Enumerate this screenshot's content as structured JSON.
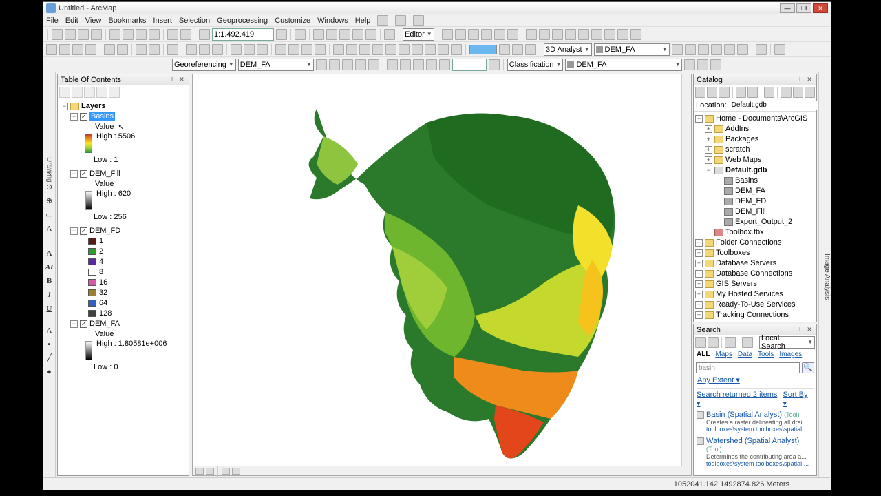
{
  "window": {
    "title": "Untitled - ArcMap"
  },
  "menu": [
    "File",
    "Edit",
    "View",
    "Bookmarks",
    "Insert",
    "Selection",
    "Geoprocessing",
    "Customize",
    "Windows",
    "Help"
  ],
  "toolbar1": {
    "scale": "1:1.492.419"
  },
  "toolbar2": {
    "analyst_label": "3D Analyst",
    "analyst_layer": "DEM_FA"
  },
  "toolbar3": {
    "georef_label": "Georeferencing",
    "georef_layer": "DEM_FA",
    "class_label": "Classification",
    "class_layer": "DEM_FA",
    "editor_label": "Editor"
  },
  "toc": {
    "title": "Table Of Contents",
    "root": "Layers",
    "layers": [
      {
        "name": "Basins",
        "selected": true,
        "value_label": "Value",
        "high": "High : 5506",
        "low": "Low : 1",
        "ramp": "greenred"
      },
      {
        "name": "DEM_Fill",
        "value_label": "Value",
        "high": "High : 620",
        "low": "Low : 256",
        "ramp": "gray"
      },
      {
        "name": "DEM_FD",
        "classes": [
          {
            "c": "#5a1a1a",
            "v": "1"
          },
          {
            "c": "#2aa02a",
            "v": "2"
          },
          {
            "c": "#5a2aa0",
            "v": "4"
          },
          {
            "c": "#ffffff",
            "v": "8"
          },
          {
            "c": "#d858a8",
            "v": "16"
          },
          {
            "c": "#a08030",
            "v": "32"
          },
          {
            "c": "#3060c0",
            "v": "64"
          },
          {
            "c": "#404040",
            "v": "128"
          }
        ]
      },
      {
        "name": "DEM_FA",
        "value_label": "Value",
        "high": "High : 1.80581e+006",
        "low": "Low : 0",
        "ramp": "gray"
      }
    ]
  },
  "catalog": {
    "title": "Catalog",
    "location_label": "Location:",
    "location": "Default.gdb",
    "home": "Home - Documents\\ArcGIS",
    "home_children": [
      "AddIns",
      "Packages",
      "scratch",
      "Web Maps"
    ],
    "gdb": {
      "name": "Default.gdb",
      "items": [
        "Basins",
        "DEM_FA",
        "DEM_FD",
        "DEM_Fill",
        "Export_Output_2"
      ]
    },
    "toolbox": "Toolbox.tbx",
    "conns": [
      "Folder Connections",
      "Toolboxes",
      "Database Servers",
      "Database Connections",
      "GIS Servers",
      "My Hosted Services",
      "Ready-To-Use Services",
      "Tracking Connections"
    ]
  },
  "search": {
    "title": "Search",
    "local": "Local Search",
    "tabs": [
      "ALL",
      "Maps",
      "Data",
      "Tools",
      "Images"
    ],
    "query": "basin",
    "extent": "Any Extent",
    "returned": "Search returned 2 items",
    "sortby": "Sort By",
    "results": [
      {
        "title": "Basin",
        "suite": "(Spatial Analyst)",
        "type": "(Tool)",
        "desc": "Creates a raster delineating all drai...",
        "path": "toolboxes\\system toolboxes\\spatial ..."
      },
      {
        "title": "Watershed",
        "suite": "(Spatial Analyst)",
        "type": "(Tool)",
        "desc": "Determines the contributing area a...",
        "path": "toolboxes\\system toolboxes\\spatial ..."
      }
    ]
  },
  "status": {
    "coords": "1052041.142 1492874.826 Meters"
  },
  "right_tab": "Image Analysis"
}
